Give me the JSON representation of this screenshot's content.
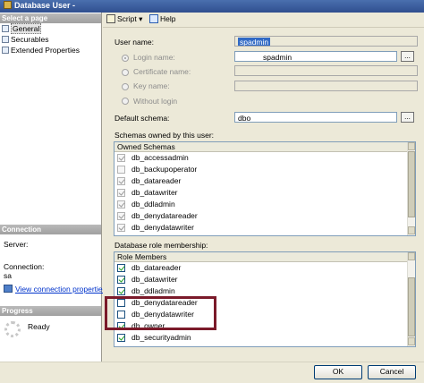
{
  "window": {
    "title": "Database User -"
  },
  "left": {
    "select_page_header": "Select a page",
    "pages": [
      {
        "label": "General",
        "selected": true
      },
      {
        "label": "Securables",
        "selected": false
      },
      {
        "label": "Extended Properties",
        "selected": false
      }
    ],
    "connection_header": "Connection",
    "server_label": "Server:",
    "connection_label": "Connection:",
    "connection_value": "sa",
    "view_connection_link": "View connection properties",
    "progress_header": "Progress",
    "progress_status": "Ready"
  },
  "toolbar": {
    "script_label": "Script",
    "help_label": "Help"
  },
  "general": {
    "user_name_label": "User name:",
    "user_name_value": "spadmin",
    "login_name_label": "Login name:",
    "login_name_value": "spadmin",
    "certificate_name_label": "Certificate name:",
    "key_name_label": "Key name:",
    "without_login_label": "Without login",
    "default_schema_label": "Default schema:",
    "default_schema_value": "dbo",
    "browse_label": "..."
  },
  "schemas": {
    "section_label": "Schemas owned by this user:",
    "column_header": "Owned Schemas",
    "items": [
      {
        "name": "db_accessadmin",
        "checked": true
      },
      {
        "name": "db_backupoperator",
        "checked": false
      },
      {
        "name": "db_datareader",
        "checked": true
      },
      {
        "name": "db_datawriter",
        "checked": true
      },
      {
        "name": "db_ddladmin",
        "checked": true
      },
      {
        "name": "db_denydatareader",
        "checked": true
      },
      {
        "name": "db_denydatawriter",
        "checked": true
      }
    ]
  },
  "roles": {
    "section_label": "Database role membership:",
    "column_header": "Role Members",
    "items": [
      {
        "name": "db_datareader",
        "checked": true
      },
      {
        "name": "db_datawriter",
        "checked": true
      },
      {
        "name": "db_ddladmin",
        "checked": true
      },
      {
        "name": "db_denydatareader",
        "checked": false
      },
      {
        "name": "db_denydatawriter",
        "checked": false
      },
      {
        "name": "db_owner",
        "checked": true
      },
      {
        "name": "db_securityadmin",
        "checked": true
      }
    ]
  },
  "buttons": {
    "ok_label": "OK",
    "cancel_label": "Cancel"
  },
  "colors": {
    "highlight_border": "#7b1a2a",
    "title_bar": "#2f4f8f",
    "check_green": "#21a121"
  }
}
